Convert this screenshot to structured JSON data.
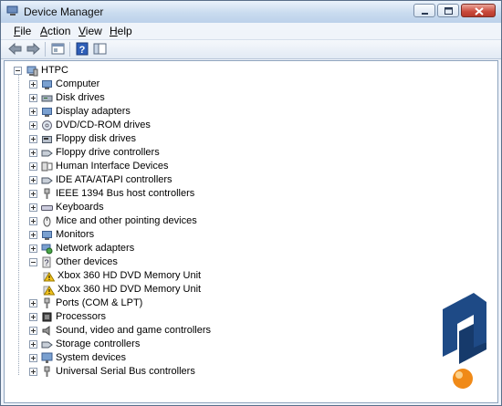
{
  "window": {
    "title": "Device Manager"
  },
  "menu": [
    {
      "key": "F",
      "rest": "ile"
    },
    {
      "key": "A",
      "rest": "ction"
    },
    {
      "key": "V",
      "rest": "iew"
    },
    {
      "key": "H",
      "rest": "elp"
    }
  ],
  "toolbar": {
    "icons": [
      "back-icon",
      "forward-icon",
      "properties-view-icon",
      "help-icon",
      "show-hide-console-tree-icon"
    ]
  },
  "tree": {
    "root": "HTPC",
    "categories": [
      "Computer",
      "Disk drives",
      "Display adapters",
      "DVD/CD-ROM drives",
      "Floppy disk drives",
      "Floppy drive controllers",
      "Human Interface Devices",
      "IDE ATA/ATAPI controllers",
      "IEEE 1394 Bus host controllers",
      "Keyboards",
      "Mice and other pointing devices",
      "Monitors",
      "Network adapters",
      "Other devices",
      "Xbox 360 HD DVD Memory Unit",
      "Xbox 360 HD DVD Memory Unit",
      "Ports (COM & LPT)",
      "Processors",
      "Sound, video and game controllers",
      "Storage controllers",
      "System devices",
      "Universal Serial Bus controllers"
    ]
  },
  "colors": {
    "accent": "#3a6ea5",
    "warning": "#f2c21b",
    "watermark": "#1e4a86",
    "orb": "#f08a18"
  }
}
